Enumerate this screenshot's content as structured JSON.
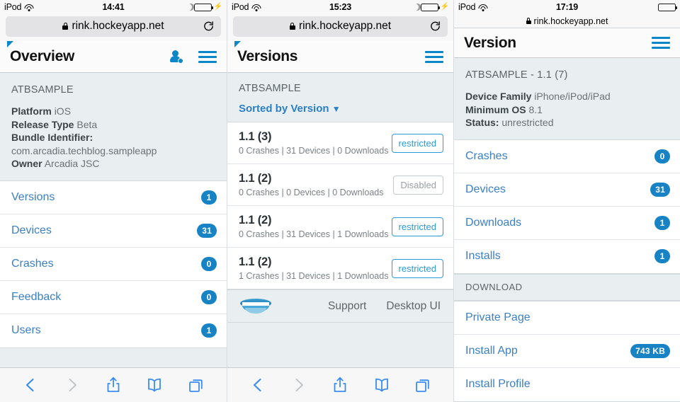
{
  "panels": [
    {
      "status": {
        "carrier": "iPod",
        "time": "14:41",
        "battery": "green",
        "dnd": true,
        "charging": true
      },
      "browser": {
        "url": "rink.hockeyapp.net",
        "reload_icon": "reload-icon",
        "lock_icon": "lock-icon"
      },
      "navbar": {
        "title": "Overview",
        "account_icon": "person-settings-icon",
        "menu_icon": "hamburger-menu-icon"
      },
      "info": {
        "app_name": "ATBSAMPLE",
        "fields": [
          {
            "label": "Platform",
            "value": "iOS"
          },
          {
            "label": "Release Type",
            "value": "Beta"
          },
          {
            "label": "Bundle Identifier:",
            "value": ""
          },
          {
            "label": "",
            "value": "com.arcadia.techblog.sampleapp"
          },
          {
            "label": "Owner",
            "value": "Arcadia JSC"
          }
        ]
      },
      "list": [
        {
          "label": "Versions",
          "badge": "1"
        },
        {
          "label": "Devices",
          "badge": "31"
        },
        {
          "label": "Crashes",
          "badge": "0"
        },
        {
          "label": "Feedback",
          "badge": "0"
        },
        {
          "label": "Users",
          "badge": "1"
        }
      ],
      "toolbar": {
        "back_icon": "back-chevron-icon",
        "forward_icon": "forward-chevron-icon",
        "share_icon": "share-icon",
        "bookmarks_icon": "bookmarks-book-icon",
        "tabs_icon": "tabs-icon"
      }
    },
    {
      "status": {
        "carrier": "iPod",
        "time": "15:23",
        "battery": "green",
        "dnd": true,
        "charging": true
      },
      "browser": {
        "url": "rink.hockeyapp.net",
        "reload_icon": "reload-icon",
        "lock_icon": "lock-icon"
      },
      "navbar": {
        "title": "Versions",
        "menu_icon": "hamburger-menu-icon"
      },
      "subhead": {
        "app_name": "ATBSAMPLE",
        "sort_label": "Sorted by Version",
        "sort_caret": "▼"
      },
      "versions": [
        {
          "title": "1.1 (3)",
          "stats": "0 Crashes | 31 Devices | 0 Downloads",
          "status": "restricted",
          "status_kind": "active"
        },
        {
          "title": "1.1 (2)",
          "stats": "0 Crashes | 0 Devices | 0 Downloads",
          "status": "Disabled",
          "status_kind": "disabled"
        },
        {
          "title": "1.1 (2)",
          "stats": "0 Crashes | 31 Devices | 1 Downloads",
          "status": "restricted",
          "status_kind": "active"
        },
        {
          "title": "1.1 (2)",
          "stats": "1 Crashes | 31 Devices | 1 Downloads",
          "status": "restricted",
          "status_kind": "active"
        }
      ],
      "webfooter": {
        "logo": "hockeyapp-logo",
        "links": [
          "Support",
          "Desktop UI"
        ]
      },
      "toolbar": {
        "back_icon": "back-chevron-icon",
        "forward_icon": "forward-chevron-icon",
        "share_icon": "share-icon",
        "bookmarks_icon": "bookmarks-book-icon",
        "tabs_icon": "tabs-icon"
      }
    },
    {
      "status": {
        "carrier": "iPod",
        "time": "17:19",
        "battery": "black",
        "dnd": false,
        "charging": false
      },
      "browser": {
        "url": "rink.hockeyapp.net",
        "lock_icon": "lock-icon"
      },
      "navbar": {
        "title": "Version",
        "menu_icon": "hamburger-menu-icon"
      },
      "info": {
        "app_name": "ATBSAMPLE - 1.1 (7)",
        "fields": [
          {
            "label": "Device Family",
            "value": "iPhone/iPod/iPad"
          },
          {
            "label": "Minimum OS",
            "value": "8.1"
          },
          {
            "label": "Status:",
            "value": "unrestricted"
          }
        ]
      },
      "list": [
        {
          "label": "Crashes",
          "badge": "0"
        },
        {
          "label": "Devices",
          "badge": "31"
        },
        {
          "label": "Downloads",
          "badge": "1"
        },
        {
          "label": "Installs",
          "badge": "1"
        }
      ],
      "download_section": {
        "header": "DOWNLOAD",
        "items": [
          {
            "label": "Private Page",
            "badge": ""
          },
          {
            "label": "Install App",
            "badge": "743 KB"
          },
          {
            "label": "Install Profile",
            "badge": ""
          }
        ]
      }
    }
  ],
  "colors": {
    "accent_blue": "#1883c4",
    "link_blue": "#3b7fc4",
    "icon_blue": "#0b86c8",
    "toolbar_blue": "#3b8cf0",
    "restricted_border": "#2b9ad6",
    "bg_gray": "#e9eef0",
    "battery_green": "#4cd964"
  }
}
